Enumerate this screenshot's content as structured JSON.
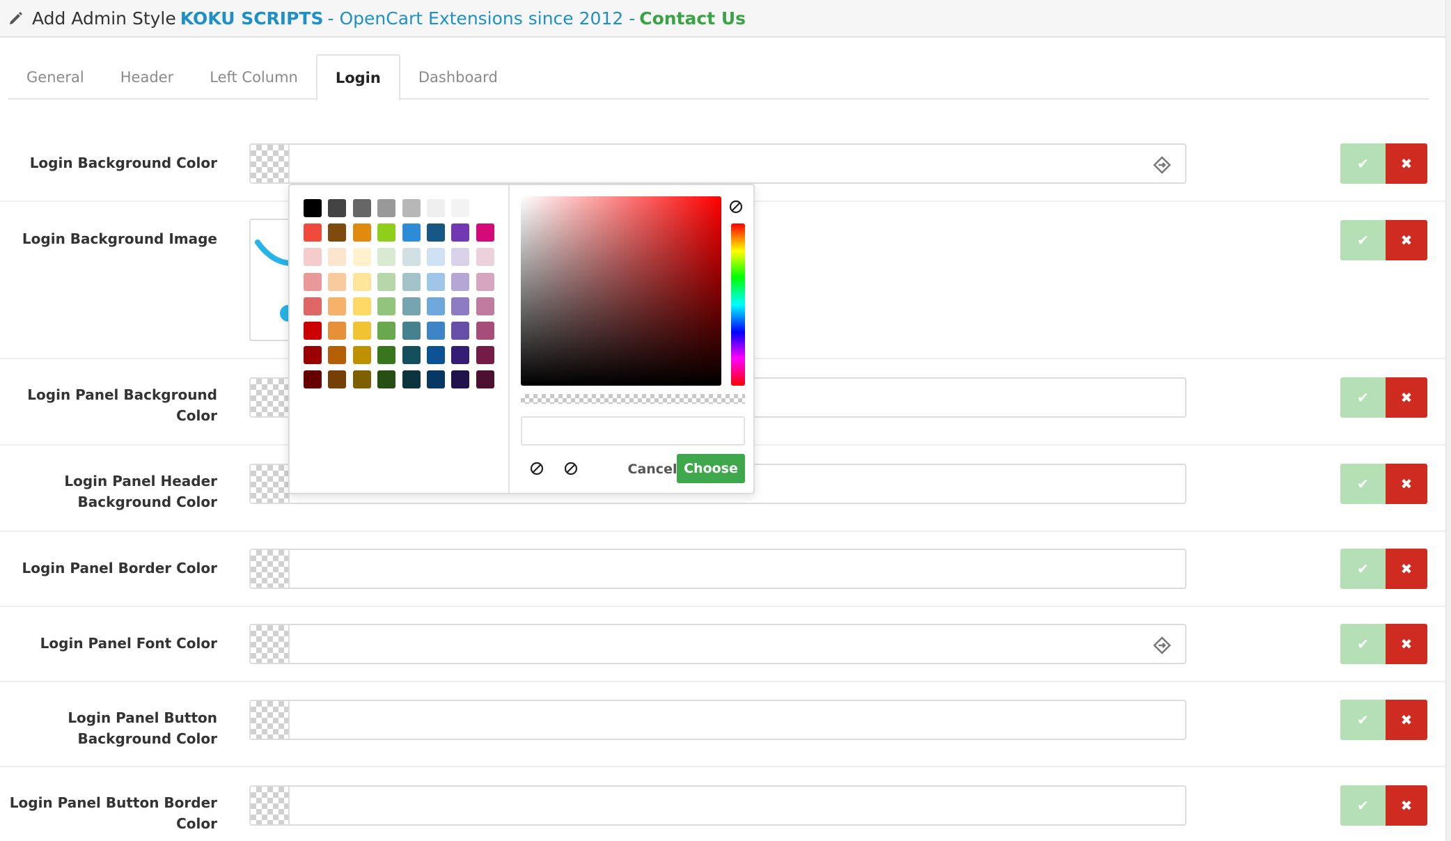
{
  "header": {
    "prefix": "Add Admin Style",
    "brand": "KOKU SCRIPTS",
    "tagline": "- OpenCart Extensions since 2012 -",
    "contact": "Contact Us",
    "icon": "pencil-icon"
  },
  "tabs": [
    {
      "label": "General",
      "active": false
    },
    {
      "label": "Header",
      "active": false
    },
    {
      "label": "Left Column",
      "active": false
    },
    {
      "label": "Login",
      "active": true
    },
    {
      "label": "Dashboard",
      "active": false
    }
  ],
  "fields": [
    {
      "label": "Login Background Color",
      "value": ""
    },
    {
      "label": "Login Background Image",
      "value": ""
    },
    {
      "label": "Login Panel Background Color",
      "value": ""
    },
    {
      "label": "Login Panel Header Background Color",
      "value": ""
    },
    {
      "label": "Login Panel Border Color",
      "value": ""
    },
    {
      "label": "Login Panel Font Color",
      "value": ""
    },
    {
      "label": "Login Panel Button Background Color",
      "value": ""
    },
    {
      "label": "Login Panel Button Border Color",
      "value": ""
    }
  ],
  "buttons": {
    "confirm_icon": "check-icon",
    "clear_icon": "close-icon",
    "confirm_color": "#b5e0b5",
    "clear_color": "#d02b20"
  },
  "picker": {
    "cancel_label": "Cancel",
    "choose_label": "Choose",
    "input_value": "",
    "hue": "#ff0000",
    "palette": [
      [
        "#000000",
        "#434343",
        "#666666",
        "#999999",
        "#b7b7b7",
        "#efefef",
        "#f3f3f3",
        ""
      ],
      [
        "#ee4b3c",
        "#7f4a0d",
        "#e08b0f",
        "#8fce1a",
        "#2e8bd6",
        "#175783",
        "#7238b4",
        "#d30a78"
      ],
      [
        "#f4cccc",
        "#fce5cd",
        "#fff2cc",
        "#d9ead3",
        "#d0e0e3",
        "#cfe2f3",
        "#d9d2e9",
        "#ead1dc"
      ],
      [
        "#ea9999",
        "#f9cb9c",
        "#ffe599",
        "#b6d7a8",
        "#a2c4c9",
        "#9fc5e8",
        "#b4a7d6",
        "#d5a6bd"
      ],
      [
        "#e06666",
        "#f6b26b",
        "#ffd966",
        "#93c47d",
        "#76a5af",
        "#6fa8dc",
        "#8e7cc3",
        "#c27ba0"
      ],
      [
        "#cc0000",
        "#e69138",
        "#f1c232",
        "#6aa84f",
        "#45818e",
        "#3d85c6",
        "#674ea7",
        "#a64d79"
      ],
      [
        "#990000",
        "#b45f06",
        "#bf9000",
        "#38761d",
        "#134f5c",
        "#0b5394",
        "#351c75",
        "#741b47"
      ],
      [
        "#660000",
        "#783f04",
        "#7f6000",
        "#274e13",
        "#0c343d",
        "#073763",
        "#20124d",
        "#4c1130"
      ]
    ]
  }
}
